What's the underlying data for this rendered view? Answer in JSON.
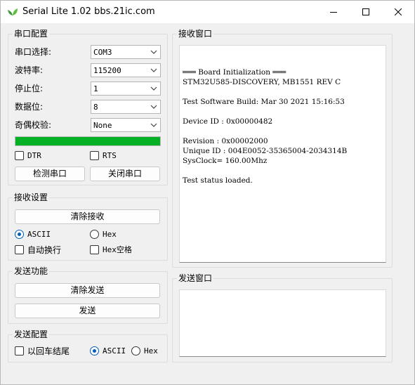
{
  "window": {
    "title": "Serial Lite 1.02 bbs.21ic.com"
  },
  "serial_config": {
    "title": "串口配置",
    "port_label": "串口选择:",
    "port_value": "COM3",
    "baud_label": "波特率:",
    "baud_value": "115200",
    "stop_label": "停止位:",
    "stop_value": "1",
    "data_label": "数据位:",
    "data_value": "8",
    "parity_label": "奇偶校验:",
    "parity_value": "None",
    "progress": 1.0,
    "progress_color": "#06b025",
    "dtr_label": "DTR",
    "rts_label": "RTS",
    "detect_button": "检测串口",
    "close_button": "关闭串口"
  },
  "rx_settings": {
    "title": "接收设置",
    "clear_button": "清除接收",
    "ascii_label": "ASCII",
    "hex_label": "Hex",
    "autowrap_label": "自动换行",
    "hexspace_label": "Hex空格"
  },
  "tx_function": {
    "title": "发送功能",
    "clear_button": "清除发送",
    "send_button": "发送"
  },
  "tx_config": {
    "title": "发送配置",
    "crlf_label": "以回车结尾",
    "ascii_label": "ASCII",
    "hex_label": "Hex"
  },
  "rx_window": {
    "title": "接收窗口",
    "lines": [
      "═══ Board Initialization ═══",
      "STM32U585-DISCOVERY, MB1551 REV C",
      "",
      "Test Software Build: Mar 30 2021 15:16:53",
      "",
      "Device ID : 0x00000482",
      "",
      "Revision : 0x00002000",
      "Unique ID : 004E0052-35365004-2034314B",
      "SysClock= 160.00Mhz",
      "",
      "Test status loaded."
    ]
  },
  "tx_window": {
    "title": "发送窗口",
    "content": ""
  },
  "accent_color": "#005fb8"
}
